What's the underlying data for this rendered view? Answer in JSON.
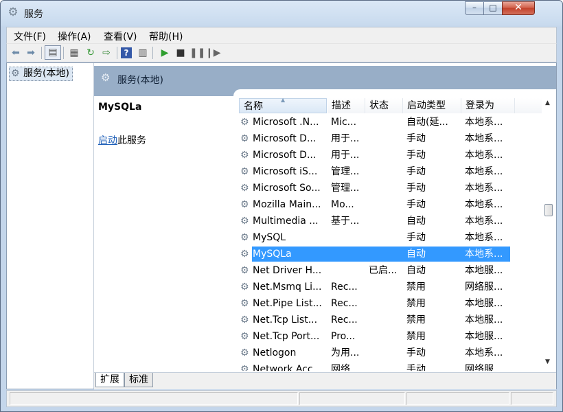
{
  "window": {
    "title": "服务",
    "controls": {
      "minimize": "–",
      "maximize": "□",
      "close": "✕"
    }
  },
  "menu": [
    "文件(F)",
    "操作(A)",
    "查看(V)",
    "帮助(H)"
  ],
  "toolbar_icons": [
    "back-arrow-icon",
    "forward-arrow-icon",
    "console-tree-icon",
    "properties-icon",
    "refresh-icon",
    "export-list-icon",
    "help-icon",
    "show-hide-icon",
    "play-icon",
    "stop-icon",
    "pause-icon",
    "restart-icon"
  ],
  "tree": {
    "root_label": "服务(本地)"
  },
  "panel_header": "服务(本地)",
  "description_pane": {
    "service_name": "MySQLa",
    "start_link": "启动",
    "start_suffix": "此服务"
  },
  "columns": [
    "名称",
    "描述",
    "状态",
    "启动类型",
    "登录为"
  ],
  "rows": [
    {
      "name": "Microsoft .N...",
      "desc": "Mic...",
      "status": "",
      "startup": "自动(延...",
      "logon": "本地系..."
    },
    {
      "name": "Microsoft D...",
      "desc": "用于...",
      "status": "",
      "startup": "手动",
      "logon": "本地系..."
    },
    {
      "name": "Microsoft D...",
      "desc": "用于...",
      "status": "",
      "startup": "手动",
      "logon": "本地系..."
    },
    {
      "name": "Microsoft iS...",
      "desc": "管理...",
      "status": "",
      "startup": "手动",
      "logon": "本地系..."
    },
    {
      "name": "Microsoft So...",
      "desc": "管理...",
      "status": "",
      "startup": "手动",
      "logon": "本地系..."
    },
    {
      "name": "Mozilla Main...",
      "desc": "Mo...",
      "status": "",
      "startup": "手动",
      "logon": "本地系..."
    },
    {
      "name": "Multimedia ...",
      "desc": "基于...",
      "status": "",
      "startup": "自动",
      "logon": "本地系..."
    },
    {
      "name": "MySQL",
      "desc": "",
      "status": "",
      "startup": "手动",
      "logon": "本地系..."
    },
    {
      "name": "MySQLa",
      "desc": "",
      "status": "",
      "startup": "自动",
      "logon": "本地系...",
      "selected": true
    },
    {
      "name": "Net Driver H...",
      "desc": "",
      "status": "已启...",
      "startup": "自动",
      "logon": "本地服..."
    },
    {
      "name": "Net.Msmq Li...",
      "desc": "Rec...",
      "status": "",
      "startup": "禁用",
      "logon": "网络服..."
    },
    {
      "name": "Net.Pipe List...",
      "desc": "Rec...",
      "status": "",
      "startup": "禁用",
      "logon": "本地服..."
    },
    {
      "name": "Net.Tcp List...",
      "desc": "Rec...",
      "status": "",
      "startup": "禁用",
      "logon": "本地服..."
    },
    {
      "name": "Net.Tcp Port...",
      "desc": "Pro...",
      "status": "",
      "startup": "禁用",
      "logon": "本地服..."
    },
    {
      "name": "Netlogon",
      "desc": "为用...",
      "status": "",
      "startup": "手动",
      "logon": "本地系..."
    },
    {
      "name": "Network Acc...",
      "desc": "网络...",
      "status": "",
      "startup": "手动",
      "logon": "网络服..."
    }
  ],
  "tabs": [
    "扩展",
    "标准"
  ],
  "colors": {
    "selection": "#3399ff",
    "header_band": "#98aec7",
    "link": "#1e5fb8"
  }
}
